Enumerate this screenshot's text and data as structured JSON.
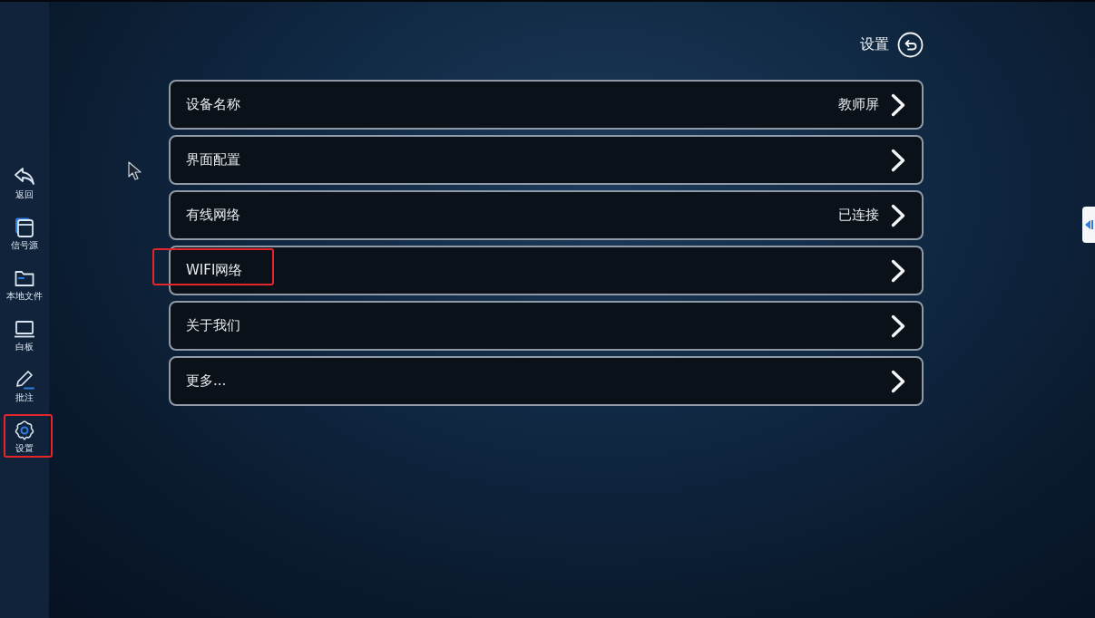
{
  "header": {
    "title": "设置"
  },
  "sidebar": {
    "items": [
      {
        "kind": "back",
        "label": "返回",
        "highlighted": false
      },
      {
        "kind": "source",
        "label": "信号源",
        "highlighted": false
      },
      {
        "kind": "folder",
        "label": "本地文件",
        "highlighted": false
      },
      {
        "kind": "whiteboard",
        "label": "白板",
        "highlighted": false
      },
      {
        "kind": "annotate",
        "label": "批注",
        "highlighted": false
      },
      {
        "kind": "settings",
        "label": "设置",
        "highlighted": true
      }
    ]
  },
  "settings": {
    "rows": [
      {
        "label": "设备名称",
        "value": "教师屏",
        "highlighted": false
      },
      {
        "label": "界面配置",
        "highlighted": false
      },
      {
        "label": "有线网络",
        "value": "已连接",
        "highlighted": false
      },
      {
        "label": "WIFI网络",
        "highlighted": true
      },
      {
        "label": "关于我们",
        "highlighted": false
      },
      {
        "label": "更多...",
        "highlighted": false
      }
    ]
  }
}
